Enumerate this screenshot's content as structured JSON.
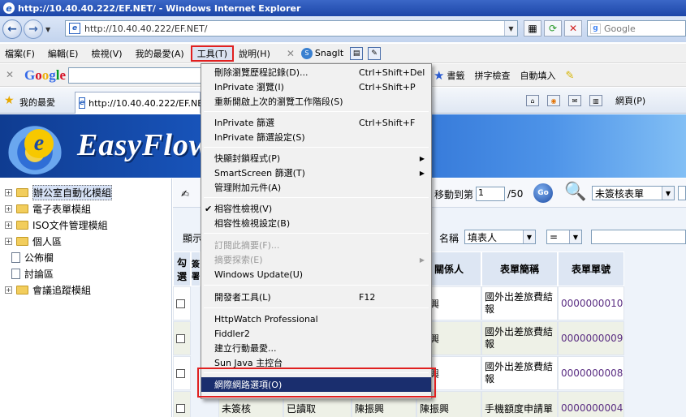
{
  "window": {
    "title": "http://10.40.40.222/EF.NET/ - Windows Internet Explorer"
  },
  "address": {
    "url": "http://10.40.40.222/EF.NET/",
    "search_placeholder": "Google"
  },
  "menubar": {
    "items": [
      "檔案(F)",
      "編輯(E)",
      "檢視(V)",
      "我的最愛(A)",
      "工具(T)",
      "說明(H)"
    ],
    "snagit_label": "SnagIt"
  },
  "google_toolbar": {
    "logo": "Google",
    "bookmarks_label": "書籤",
    "spellcheck_label": "拼字檢查",
    "autofill_label": "自動填入"
  },
  "favorites_bar": {
    "favorites_label": "我的最愛",
    "tab_title": "http://10.40.40.222/EF.NET",
    "page_label": "網頁(P)"
  },
  "banner": {
    "brand": "EasyFlow"
  },
  "sidebar": {
    "items": [
      {
        "label": "辦公室自動化模組",
        "type": "folder",
        "selected": true
      },
      {
        "label": "電子表單模組",
        "type": "folder",
        "selected": false
      },
      {
        "label": "ISO文件管理模組",
        "type": "folder",
        "selected": false
      },
      {
        "label": "個人區",
        "type": "folder",
        "selected": false
      },
      {
        "label": "公佈欄",
        "type": "doc",
        "selected": false
      },
      {
        "label": "討論區",
        "type": "doc",
        "selected": false
      },
      {
        "label": "會議追蹤模組",
        "type": "folder",
        "selected": false
      }
    ]
  },
  "main": {
    "move_to_label": "移動到第",
    "page_value": "1",
    "page_total": "/50",
    "go_label": "Go",
    "status_filter": "未簽核表單",
    "show_label": "顯示",
    "field_name_label": "名稱",
    "field_select": "填表人",
    "operator_select": "=",
    "columns": {
      "check": "勾選",
      "status_partial": "簽署",
      "related": "關係人",
      "form_name": "表單簡稱",
      "form_no": "表單單號"
    },
    "rows": [
      {
        "related": "振興",
        "form_name": "國外出差旅費結報",
        "form_no": "0000000010"
      },
      {
        "related": "振興",
        "form_name": "國外出差旅費結報",
        "form_no": "0000000009"
      },
      {
        "related": "振興",
        "form_name": "國外出差旅費結報",
        "form_no": "0000000008"
      },
      {
        "c1": "未簽核",
        "c2": "已讀取",
        "c3": "陳振興",
        "related": "陳振興",
        "form_name": "手機額度申請單",
        "form_no": "0000000004"
      }
    ]
  },
  "tools_menu": {
    "items": [
      {
        "label": "刪除瀏覽歷程記錄(D)...",
        "shortcut": "Ctrl+Shift+Del"
      },
      {
        "label": "InPrivate 瀏覽(I)",
        "shortcut": "Ctrl+Shift+P"
      },
      {
        "label": "重新開啟上次的瀏覽工作階段(S)"
      },
      {
        "label": "InPrivate 篩選",
        "shortcut": "Ctrl+Shift+F"
      },
      {
        "label": "InPrivate 篩選設定(S)"
      },
      {
        "label": "快顯封鎖程式(P)"
      },
      {
        "label": "SmartScreen 篩選(T)"
      },
      {
        "label": "管理附加元件(A)"
      },
      {
        "label": "相容性檢視(V)"
      },
      {
        "label": "相容性檢視設定(B)"
      },
      {
        "label": "訂閱此摘要(F)..."
      },
      {
        "label": "摘要探索(E)"
      },
      {
        "label": "Windows Update(U)"
      },
      {
        "label": "開發者工具(L)",
        "shortcut": "F12"
      },
      {
        "label": "HttpWatch Professional"
      },
      {
        "label": "Fiddler2"
      },
      {
        "label": "建立行動最愛..."
      },
      {
        "label": "Sun Java 主控台"
      },
      {
        "label": "網際網路選項(O)"
      }
    ]
  },
  "colors": {
    "menu_highlight": "#1a2e6e",
    "red_annotation": "#e02020",
    "titlebar": "#1c46a8"
  }
}
